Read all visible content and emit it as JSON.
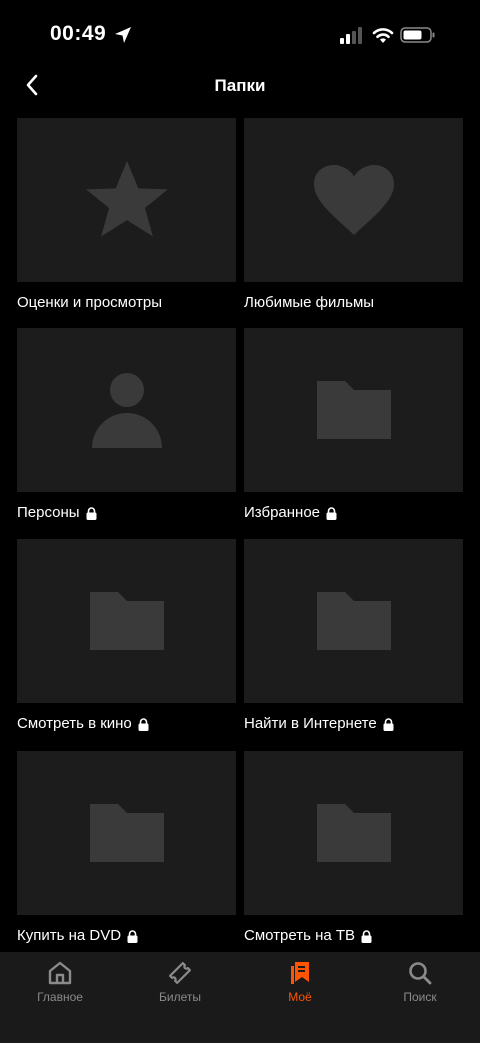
{
  "status_bar": {
    "time": "00:49"
  },
  "header": {
    "title": "Папки"
  },
  "folders": [
    {
      "label": "Оценки и просмотры",
      "icon": "star-icon",
      "locked": false
    },
    {
      "label": "Любимые фильмы",
      "icon": "heart-icon",
      "locked": false
    },
    {
      "label": "Персоны",
      "icon": "person-icon",
      "locked": true
    },
    {
      "label": "Избранное",
      "icon": "folder-icon",
      "locked": true
    },
    {
      "label": "Смотреть в кино",
      "icon": "folder-icon",
      "locked": true
    },
    {
      "label": "Найти в Интернете",
      "icon": "folder-icon",
      "locked": true
    },
    {
      "label": "Купить на DVD",
      "icon": "folder-icon",
      "locked": true
    },
    {
      "label": "Смотреть на ТВ",
      "icon": "folder-icon",
      "locked": true
    }
  ],
  "tab_bar": {
    "items": [
      {
        "label": "Главное",
        "icon": "home-icon",
        "active": false
      },
      {
        "label": "Билеты",
        "icon": "ticket-icon",
        "active": false
      },
      {
        "label": "Моё",
        "icon": "bookmarks-icon",
        "active": true
      },
      {
        "label": "Поиск",
        "icon": "search-icon",
        "active": false
      }
    ]
  },
  "colors": {
    "background": "#000000",
    "tile": "#1c1c1c",
    "tile_icon": "#3a3a3a",
    "tab_bar": "#1a1a1a",
    "accent": "#ff5500",
    "inactive": "#8a8a8a"
  }
}
